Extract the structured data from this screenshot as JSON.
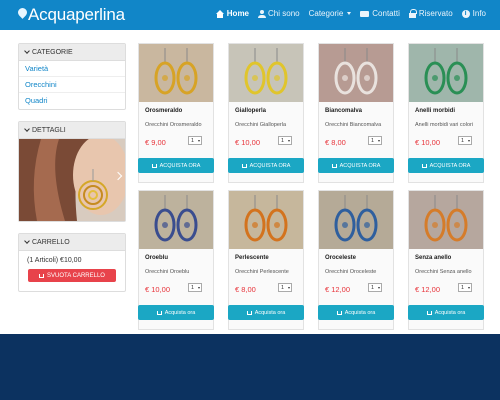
{
  "brand": {
    "name": "Acquaperlina"
  },
  "nav": {
    "items": [
      {
        "label": "Home",
        "icon": "home-icon",
        "active": true
      },
      {
        "label": "Chi sono",
        "icon": "user-icon"
      },
      {
        "label": "Categorie",
        "icon": "",
        "dropdown": true
      },
      {
        "label": "Contatti",
        "icon": "mail-icon"
      },
      {
        "label": "Riservato",
        "icon": "lock-icon"
      },
      {
        "label": "Info",
        "icon": "info-icon"
      }
    ]
  },
  "sidebar": {
    "categories": {
      "title": "CATEGORIE",
      "items": [
        {
          "label": "Varietà"
        },
        {
          "label": "Orecchini"
        },
        {
          "label": "Quadri"
        }
      ]
    },
    "details": {
      "title": "DETTAGLI"
    },
    "cart": {
      "title": "CARRELLO",
      "summary": "(1 Articoli) €10,00",
      "empty_label": "SVUOTA CARRELLO"
    }
  },
  "products": [
    {
      "name": "Orosmeraldo",
      "desc": "Orecchini Orosmeraldo",
      "price": "€ 9,00",
      "qty": "1",
      "button": "ACQUISTA ORA",
      "bg": "#c9b79f",
      "accent": "#d7a326"
    },
    {
      "name": "Gialloperla",
      "desc": "Orecchini Gialloperla",
      "price": "€ 10,00",
      "qty": "1",
      "button": "ACQUISTA ORA",
      "bg": "#c7c4b8",
      "accent": "#e0c52c"
    },
    {
      "name": "Biancomalva",
      "desc": "Orecchini Biancomalva",
      "price": "€ 8,00",
      "qty": "1",
      "button": "ACQUISTA ORA",
      "bg": "#b79b93",
      "accent": "#e9e2de"
    },
    {
      "name": "Anelli morbidi",
      "desc": "Anelli morbidi vari colori",
      "price": "€ 10,00",
      "qty": "1",
      "button": "ACQUISTA ORA",
      "bg": "#9fb6ab",
      "accent": "#2a8f55"
    },
    {
      "name": "Oroeblu",
      "desc": "Orecchini Oroeblu",
      "price": "€ 10,00",
      "qty": "1",
      "button": "Acquista ora",
      "bg": "#bdb29d",
      "accent": "#3a4d8f"
    },
    {
      "name": "Perlescente",
      "desc": "Orecchini Perlescente",
      "price": "€ 8,00",
      "qty": "1",
      "button": "Acquista ora",
      "bg": "#c6b79c",
      "accent": "#d3731e"
    },
    {
      "name": "Oroceleste",
      "desc": "Orecchini Oroceleste",
      "price": "€ 12,00",
      "qty": "1",
      "button": "Acquista ora",
      "bg": "#b5aa97",
      "accent": "#2f5f9e"
    },
    {
      "name": "Senza anello",
      "desc": "Orecchini Senza anello",
      "price": "€ 12,00",
      "qty": "1",
      "button": "Acquista ora",
      "bg": "#b6a79e",
      "accent": "#d57c2a"
    }
  ],
  "colors": {
    "navbar": "#1186c8",
    "button": "#1ba7c4",
    "price": "#e8343b",
    "danger": "#e8434b",
    "footer": "#0c3260"
  }
}
